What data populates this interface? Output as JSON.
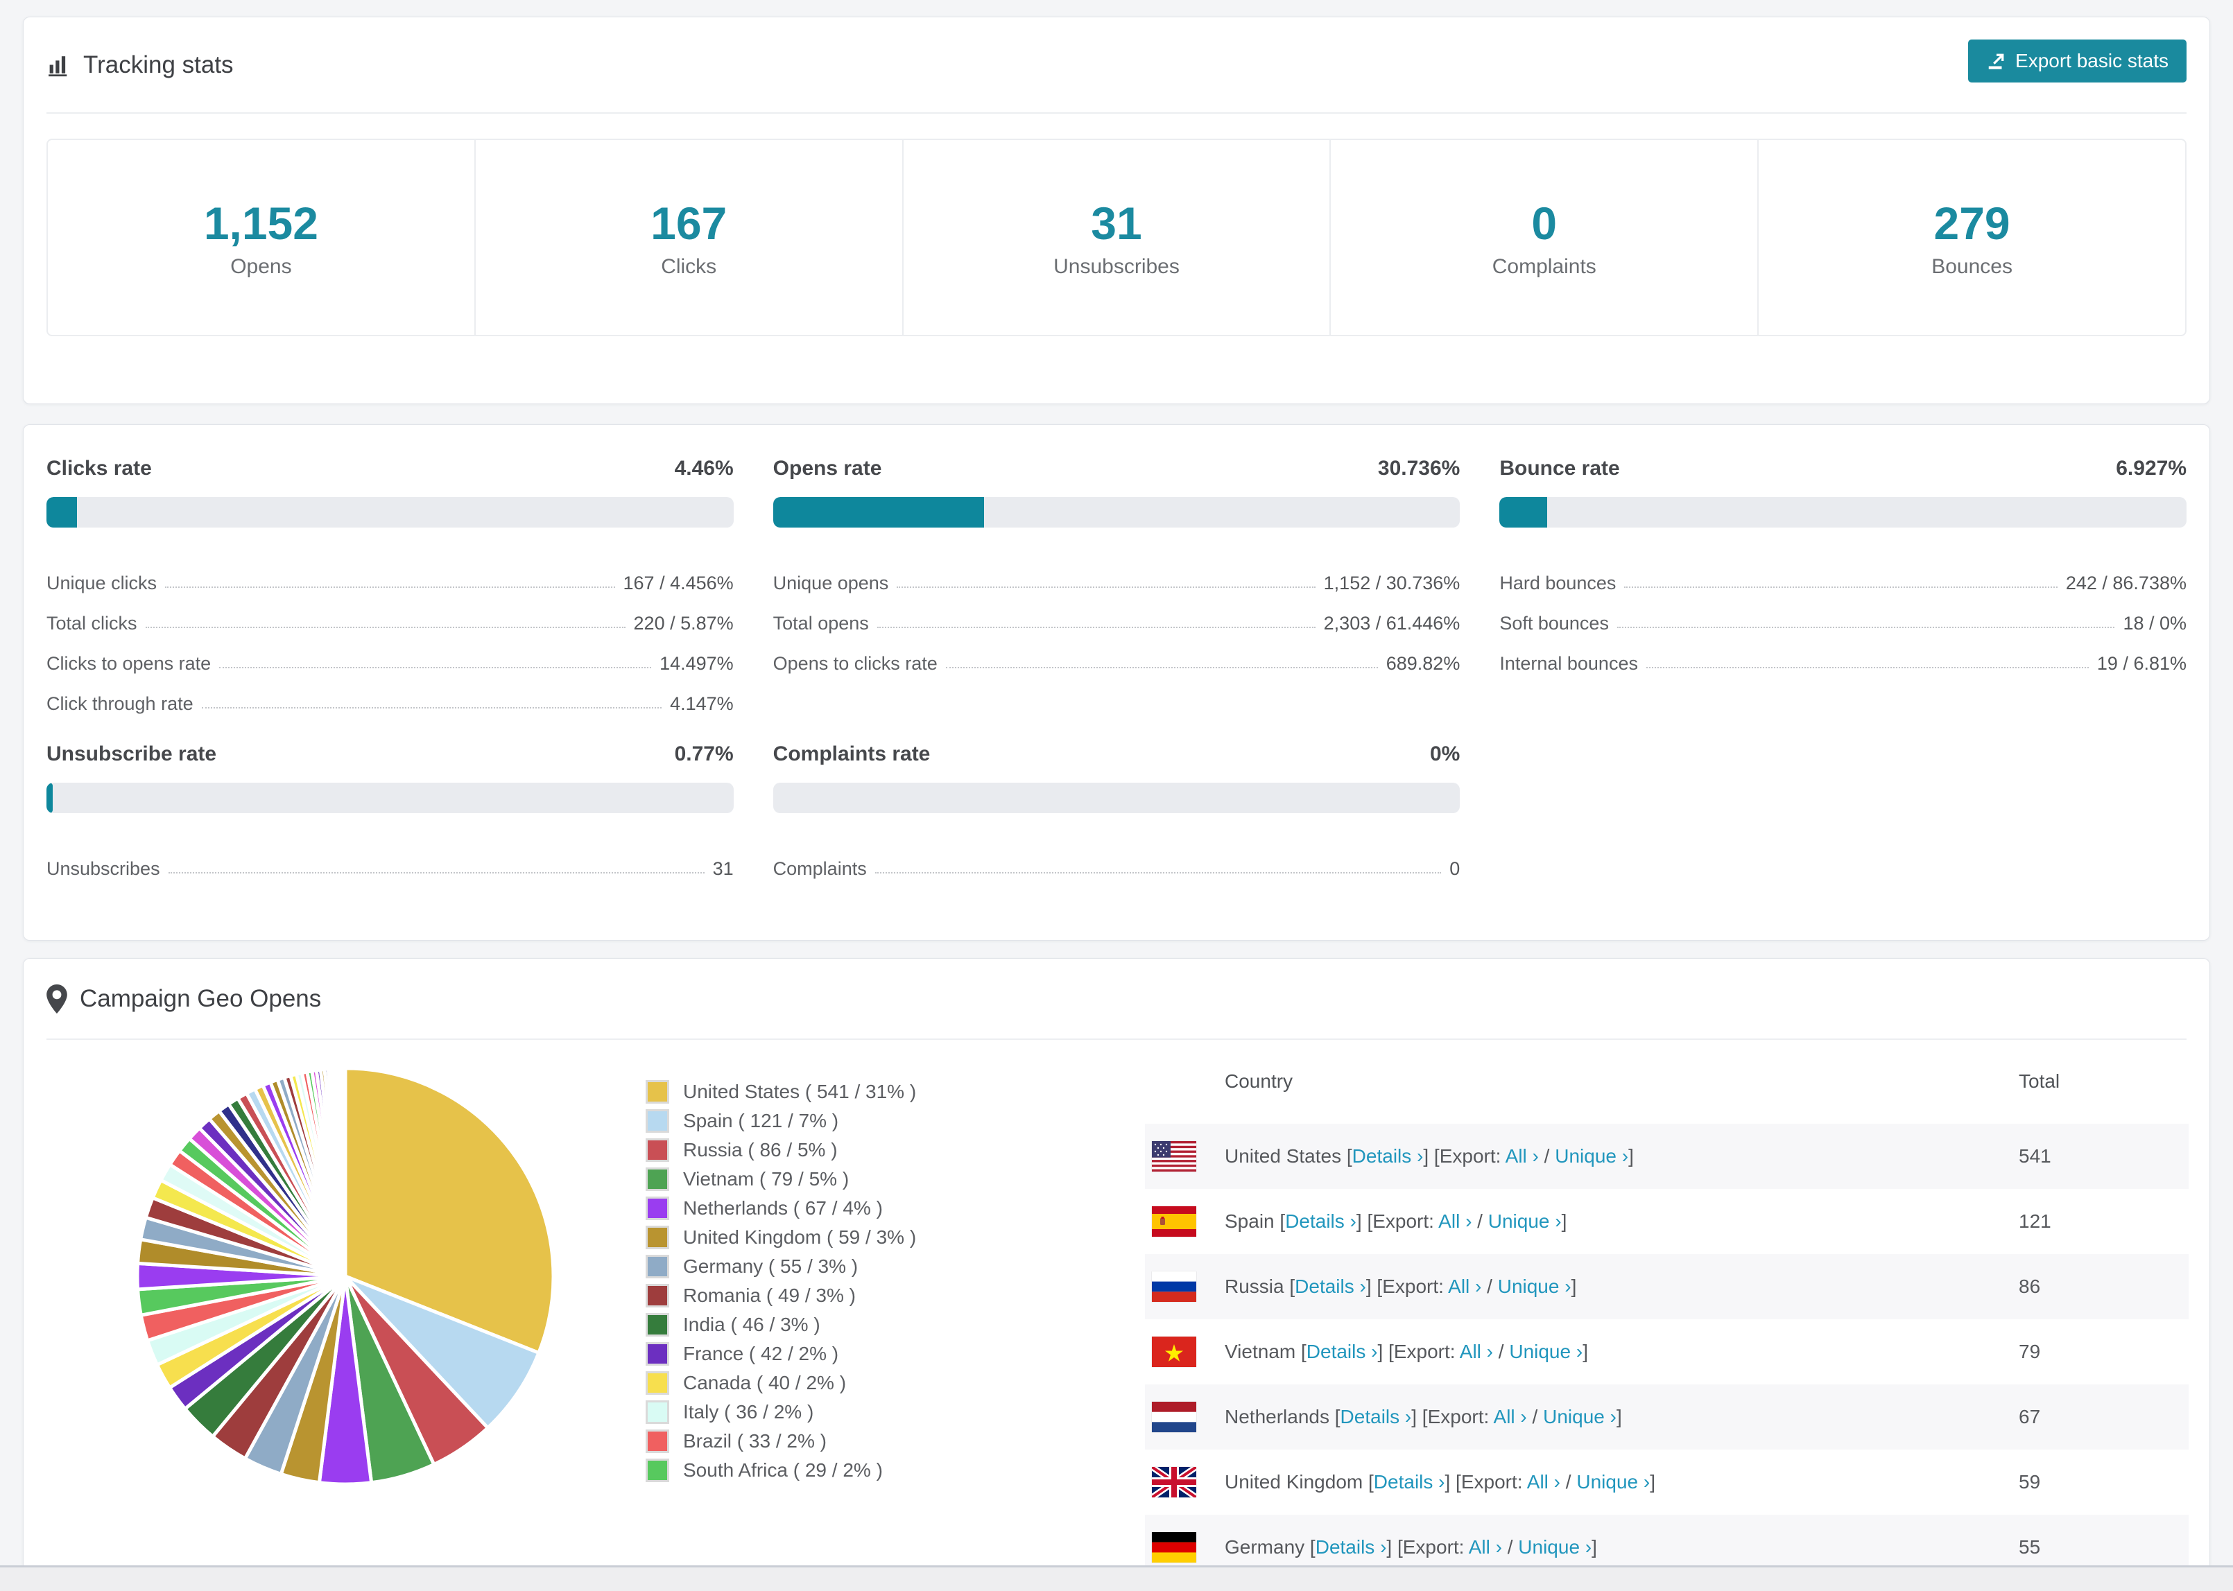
{
  "colors": {
    "accent_teal": "#1b8aa0",
    "button_teal": "#1a8a9e",
    "bar_teal": "#0e879c",
    "link_blue": "#2196bd"
  },
  "tracking": {
    "title": "Tracking stats",
    "export_button": "Export basic stats"
  },
  "stats": [
    {
      "value": "1,152",
      "label": "Opens"
    },
    {
      "value": "167",
      "label": "Clicks"
    },
    {
      "value": "31",
      "label": "Unsubscribes"
    },
    {
      "value": "0",
      "label": "Complaints"
    },
    {
      "value": "279",
      "label": "Bounces"
    }
  ],
  "rates": [
    {
      "id": "clicks",
      "title": "Clicks rate",
      "value": "4.46%",
      "percent": 4.46,
      "rows": [
        {
          "label": "Unique clicks",
          "value": "167 / 4.456%"
        },
        {
          "label": "Total clicks",
          "value": "220 / 5.87%"
        },
        {
          "label": "Clicks to opens rate",
          "value": "14.497%"
        },
        {
          "label": "Click through rate",
          "value": "4.147%"
        }
      ]
    },
    {
      "id": "opens",
      "title": "Opens rate",
      "value": "30.736%",
      "percent": 30.736,
      "rows": [
        {
          "label": "Unique opens",
          "value": "1,152 / 30.736%"
        },
        {
          "label": "Total opens",
          "value": "2,303 / 61.446%"
        },
        {
          "label": "Opens to clicks rate",
          "value": "689.82%"
        }
      ]
    },
    {
      "id": "bounce",
      "title": "Bounce rate",
      "value": "6.927%",
      "percent": 6.927,
      "rows": [
        {
          "label": "Hard bounces",
          "value": "242 / 86.738%"
        },
        {
          "label": "Soft bounces",
          "value": "18 / 0%"
        },
        {
          "label": "Internal bounces",
          "value": "19 / 6.81%"
        }
      ]
    },
    {
      "id": "unsubscribe",
      "title": "Unsubscribe rate",
      "value": "0.77%",
      "percent": 0.77,
      "rows": [
        {
          "label": "Unsubscribes",
          "value": "31"
        }
      ]
    },
    {
      "id": "complaints",
      "title": "Complaints rate",
      "value": "0%",
      "percent": 0,
      "rows": [
        {
          "label": "Complaints",
          "value": "0"
        }
      ]
    }
  ],
  "geo": {
    "title": "Campaign Geo Opens",
    "legend": [
      {
        "label": "United States ( 541 / 31% )",
        "color": "#e6c24a"
      },
      {
        "label": "Spain ( 121 / 7% )",
        "color": "#b7d9f0"
      },
      {
        "label": "Russia ( 86 / 5% )",
        "color": "#c94f55"
      },
      {
        "label": "Vietnam ( 79 / 5% )",
        "color": "#4ea353"
      },
      {
        "label": "Netherlands ( 67 / 4% )",
        "color": "#9a3df0"
      },
      {
        "label": "United Kingdom ( 59 / 3% )",
        "color": "#b99430"
      },
      {
        "label": "Germany ( 55 / 3% )",
        "color": "#8fabc6"
      },
      {
        "label": "Romania ( 49 / 3% )",
        "color": "#9e3d3d"
      },
      {
        "label": "India ( 46 / 3% )",
        "color": "#357c3c"
      },
      {
        "label": "France ( 42 / 2% )",
        "color": "#6c2fc0"
      },
      {
        "label": "Canada ( 40 / 2% )",
        "color": "#f7df4e"
      },
      {
        "label": "Italy ( 36 / 2% )",
        "color": "#d9fbf4"
      },
      {
        "label": "Brazil ( 33 / 2% )",
        "color": "#f06060"
      },
      {
        "label": "South Africa ( 29 / 2% )",
        "color": "#57c95e"
      }
    ],
    "table": {
      "headers": {
        "country": "Country",
        "total": "Total"
      },
      "link_text": {
        "details": "Details ›",
        "all": "All ›",
        "unique": "Unique ›"
      },
      "syntax": {
        "s1": " [",
        "s2": "] [Export: ",
        "s3": " / ",
        "s4": "]"
      },
      "rows": [
        {
          "country": "United States",
          "flag": "us",
          "total": "541"
        },
        {
          "country": "Spain",
          "flag": "es",
          "total": "121"
        },
        {
          "country": "Russia",
          "flag": "ru",
          "total": "86"
        },
        {
          "country": "Vietnam",
          "flag": "vn",
          "total": "79"
        },
        {
          "country": "Netherlands",
          "flag": "nl",
          "total": "67"
        },
        {
          "country": "United Kingdom",
          "flag": "gb",
          "total": "59"
        },
        {
          "country": "Germany",
          "flag": "de",
          "total": "55"
        }
      ]
    }
  },
  "chart_data": {
    "type": "pie",
    "title": "Campaign Geo Opens",
    "legend_position": "right",
    "slices": [
      {
        "name": "United States",
        "count": 541,
        "value": 31,
        "color": "#e6c24a"
      },
      {
        "name": "Spain",
        "count": 121,
        "value": 7,
        "color": "#b7d9f0"
      },
      {
        "name": "Russia",
        "count": 86,
        "value": 5,
        "color": "#c94f55"
      },
      {
        "name": "Vietnam",
        "count": 79,
        "value": 5,
        "color": "#4ea353"
      },
      {
        "name": "Netherlands",
        "count": 67,
        "value": 4,
        "color": "#9a3df0"
      },
      {
        "name": "United Kingdom",
        "count": 59,
        "value": 3,
        "color": "#b99430"
      },
      {
        "name": "Germany",
        "count": 55,
        "value": 3,
        "color": "#8fabc6"
      },
      {
        "name": "Romania",
        "count": 49,
        "value": 3,
        "color": "#9e3d3d"
      },
      {
        "name": "India",
        "count": 46,
        "value": 3,
        "color": "#357c3c"
      },
      {
        "name": "France",
        "count": 42,
        "value": 2,
        "color": "#6c2fc0"
      },
      {
        "name": "Canada",
        "count": 40,
        "value": 2,
        "color": "#f7df4e"
      },
      {
        "name": "Italy",
        "count": 36,
        "value": 2,
        "color": "#d9fbf4"
      },
      {
        "name": "Brazil",
        "count": 33,
        "value": 2,
        "color": "#f06060"
      },
      {
        "name": "South Africa",
        "count": 29,
        "value": 2,
        "color": "#57c95e"
      }
    ],
    "tail": {
      "note": "many small unlabeled countries",
      "count": 34,
      "decay": 0.93,
      "total_percent": 26,
      "palette": [
        "#9a3df0",
        "#b08c2a",
        "#8fabc6",
        "#9e3d3d",
        "#f4e84e",
        "#dffbf6",
        "#f06060",
        "#57c95e",
        "#d84fd8",
        "#6c2fc0",
        "#b99430",
        "#30308a",
        "#357c3c",
        "#c94f55",
        "#b7d9f0",
        "#e6c24a"
      ]
    }
  }
}
